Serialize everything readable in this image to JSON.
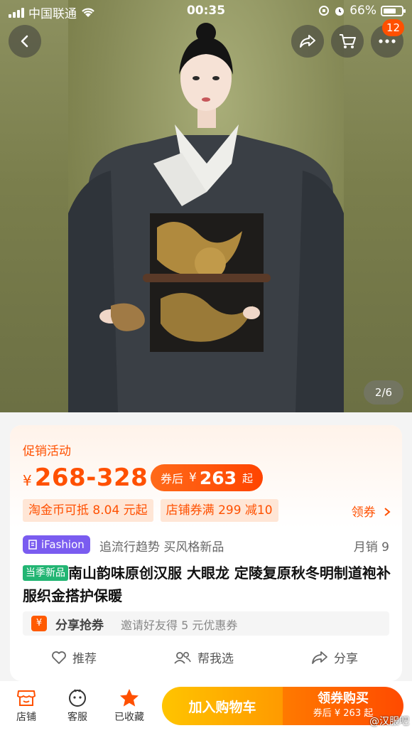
{
  "status_bar": {
    "carrier": "中国联通",
    "time": "00:35",
    "battery": "66%"
  },
  "header": {
    "cart_badge": "12",
    "page_indicator": "2/6"
  },
  "promo": {
    "label": "促销活动",
    "currency": "¥",
    "price_range": "268-328",
    "after_coupon_label": "券后",
    "after_coupon_currency": "¥",
    "after_coupon_price": "263",
    "after_coupon_suffix": "起",
    "tags": [
      "淘金币可抵 8.04 元起",
      "店铺券满 299 减10"
    ],
    "get_coupon": "领券"
  },
  "brand": {
    "badge": "iFashion",
    "slogan": "追流行趋势 买风格新品",
    "monthly_sales": "月销  9"
  },
  "product": {
    "new_tag": "当季新品",
    "title": "南山韵味原创汉服 大眼龙 定陵复原秋冬明制道袍补服织金搭护保暖"
  },
  "share_grab": {
    "icon": "¥",
    "title": "分享抢券",
    "desc": "邀请好友得 5 元优惠券"
  },
  "actions": {
    "recommend": "推荐",
    "help_choose": "帮我选",
    "share": "分享"
  },
  "bottom_bar": {
    "shop": "店铺",
    "service": "客服",
    "favorited": "已收藏",
    "add_to_cart": "加入购物车",
    "buy_main": "领券购买",
    "buy_sub": "券后 ¥ 263 起"
  },
  "watermark": "@汉服吧",
  "colors": {
    "accent": "#ff5000",
    "ifashion": "#7a5cf0",
    "new_tag": "#22b573",
    "cart_yellow": "#ffb400"
  }
}
